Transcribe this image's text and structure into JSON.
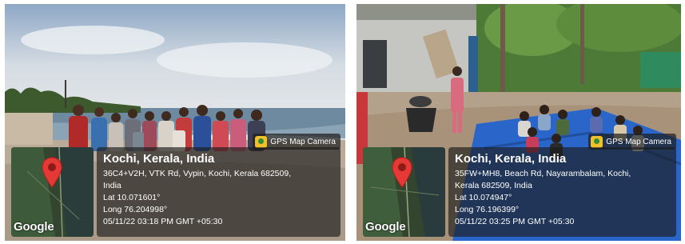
{
  "panels": [
    {
      "badge": "GPS Map Camera",
      "map_logo": "Google",
      "place": "Kochi, Kerala, India",
      "address_line1": "36C4+V2H, VTK Rd, Vypin, Kochi, Kerala 682509,",
      "address_line2": "India",
      "lat": "Lat 10.071601°",
      "long": "Long 76.204998°",
      "datetime": "05/11/22 03:18 PM GMT +05:30",
      "icons": [
        "location-pin-icon",
        "camera-icon"
      ]
    },
    {
      "badge": "GPS Map Camera",
      "map_logo": "Google",
      "place": "Kochi, Kerala, India",
      "address_line1": "35FW+MH8, Beach Rd, Nayarambalam, Kochi,",
      "address_line2": "Kerala 682509, India",
      "lat": "Lat 10.074947°",
      "long": "Long 76.196399°",
      "datetime": "05/11/22 03:25 PM GMT +05:30",
      "icons": [
        "location-pin-icon",
        "camera-icon"
      ]
    }
  ],
  "colors": {
    "pin": "#e53935",
    "sky": "#c9d3db",
    "sea": "#5f7f95",
    "sand": "#b8aa97",
    "tarp": "#2a66c9"
  }
}
